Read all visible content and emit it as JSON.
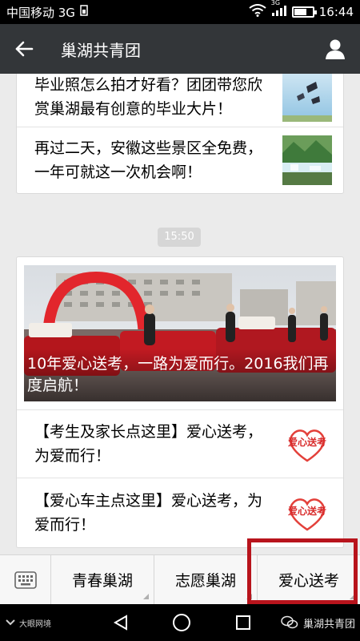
{
  "status_bar": {
    "carrier": "中国移动 3G",
    "network_label": "3G",
    "time": "16:44",
    "battery_level": 0.7
  },
  "title_bar": {
    "title": "巢湖共青团",
    "back_icon": "back-arrow-icon",
    "profile_icon": "person-icon"
  },
  "articles_top": [
    {
      "title": "毕业照怎么拍才好看？团团带您欣赏巢湖最有创意的毕业大片！"
    },
    {
      "title": "再过二天，安徽这些景区全免费，一年可就这一次机会啊！"
    }
  ],
  "timestamp": "15:50",
  "news": {
    "cover_caption": "10年爱心送考，一路为爱而行。2016我们再度启航！",
    "items": [
      {
        "title": "【考生及家长点这里】爱心送考，为爱而行！",
        "logo_text": "爱心送考"
      },
      {
        "title": "【爱心车主点这里】爱心送考，为爱而行！",
        "logo_text": "爱心送考"
      }
    ]
  },
  "menu": {
    "keyboard_icon": "keyboard-icon",
    "items": [
      {
        "label": "青春巢湖"
      },
      {
        "label": "志愿巢湖"
      },
      {
        "label": "爱心送考"
      }
    ],
    "highlight_color": "#b8141c"
  },
  "nav_bar": {
    "left_text": "大眼网境",
    "watermark": "巢湖共青团",
    "back_icon": "triangle-back-icon",
    "home_icon": "circle-home-icon",
    "recent_icon": "square-recent-icon"
  }
}
